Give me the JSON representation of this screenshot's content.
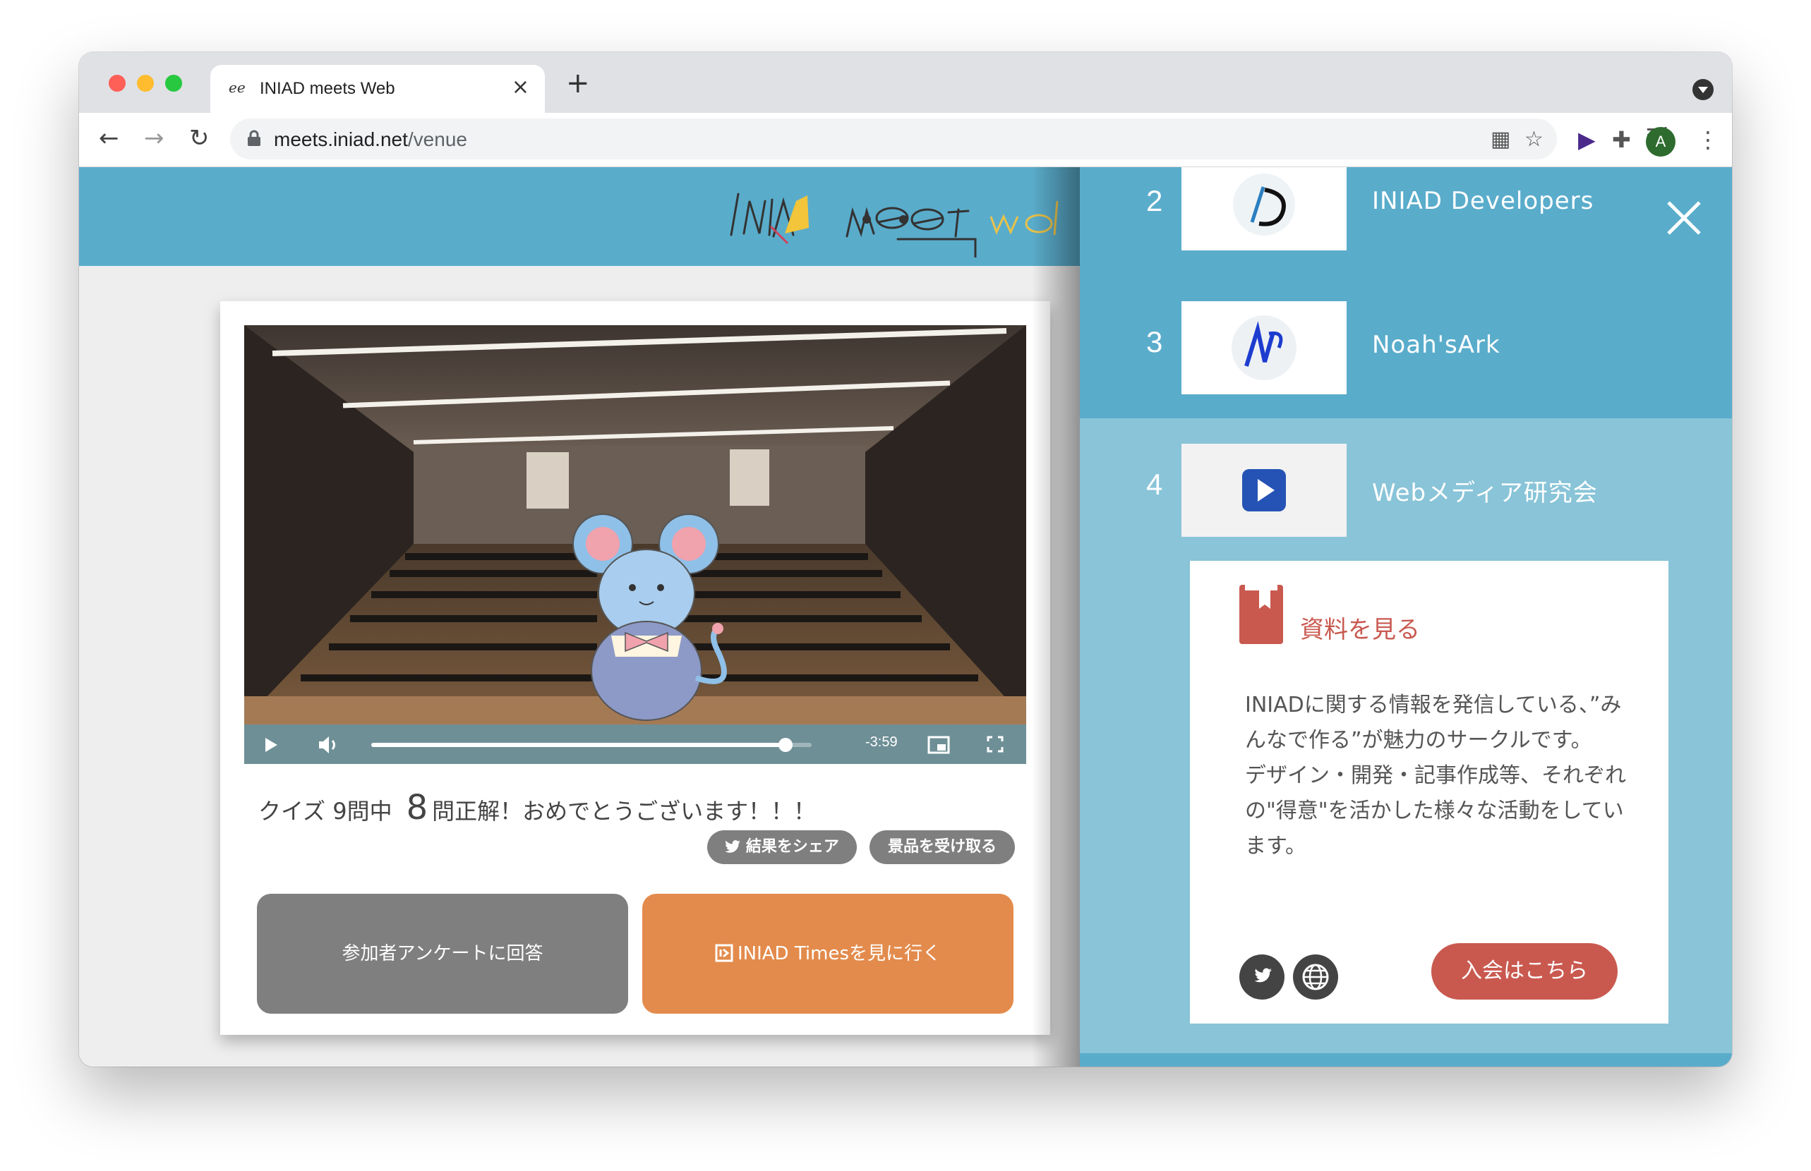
{
  "browser": {
    "tab_title": "INIAD meets Web",
    "tab_favicon": "ee",
    "url_domain": "meets.iniad.net",
    "url_path": "/venue",
    "profile_initial": "A"
  },
  "video": {
    "time_remaining": "-3:59",
    "progress": 0.94
  },
  "quiz": {
    "prefix": "クイズ 9問中",
    "correct": "8",
    "suffix": "問正解！おめでとうございます！！！",
    "share_label": "結果をシェア",
    "prize_label": "景品を受け取る"
  },
  "actions": {
    "survey_label": "参加者アンケートに回答",
    "times_label": "INIAD Timesを見に行く"
  },
  "panel": {
    "rows": [
      {
        "num": "2",
        "name": "INIAD Developers"
      },
      {
        "num": "3",
        "name": "Noah'sArk"
      },
      {
        "num": "4",
        "name": "Webメディア研究会"
      }
    ],
    "detail": {
      "doc_label": "資料を見る",
      "description": "INIADに関する情報を発信している、”みんなで作る”が魅力のサークルです。\nデザイン・開発・記事作成等、それぞれの\"得意\"を活かした様々な活動をしています。",
      "join_label": "入会はこちら"
    }
  },
  "colors": {
    "header_blue": "#5aaccb",
    "active_row": "#89c4d8",
    "survey_button": "#7f7f7f",
    "times_button": "#e38b4c",
    "join_button": "#c9594f"
  }
}
